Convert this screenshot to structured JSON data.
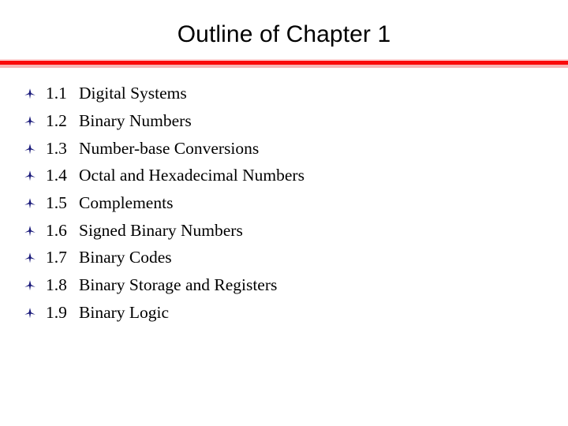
{
  "slide": {
    "title": "Outline of Chapter 1",
    "background_color": "#ffffff",
    "title_color": "#000000",
    "rule_color": "#fa0a0a",
    "rule_glow_color": "#f7b5b5",
    "bullet_color": "#19197a",
    "bullet_icon": "three-point-star-bullet-icon",
    "items": [
      {
        "number": "1.1",
        "text": "Digital Systems"
      },
      {
        "number": "1.2",
        "text": "Binary Numbers"
      },
      {
        "number": "1.3",
        "text": "Number-base Conversions"
      },
      {
        "number": "1.4",
        "text": "Octal and Hexadecimal Numbers"
      },
      {
        "number": "1.5",
        "text": "Complements"
      },
      {
        "number": "1.6",
        "text": "Signed Binary Numbers"
      },
      {
        "number": "1.7",
        "text": "Binary Codes"
      },
      {
        "number": "1.8",
        "text": "Binary Storage and Registers"
      },
      {
        "number": "1.9",
        "text": "Binary Logic"
      }
    ]
  }
}
